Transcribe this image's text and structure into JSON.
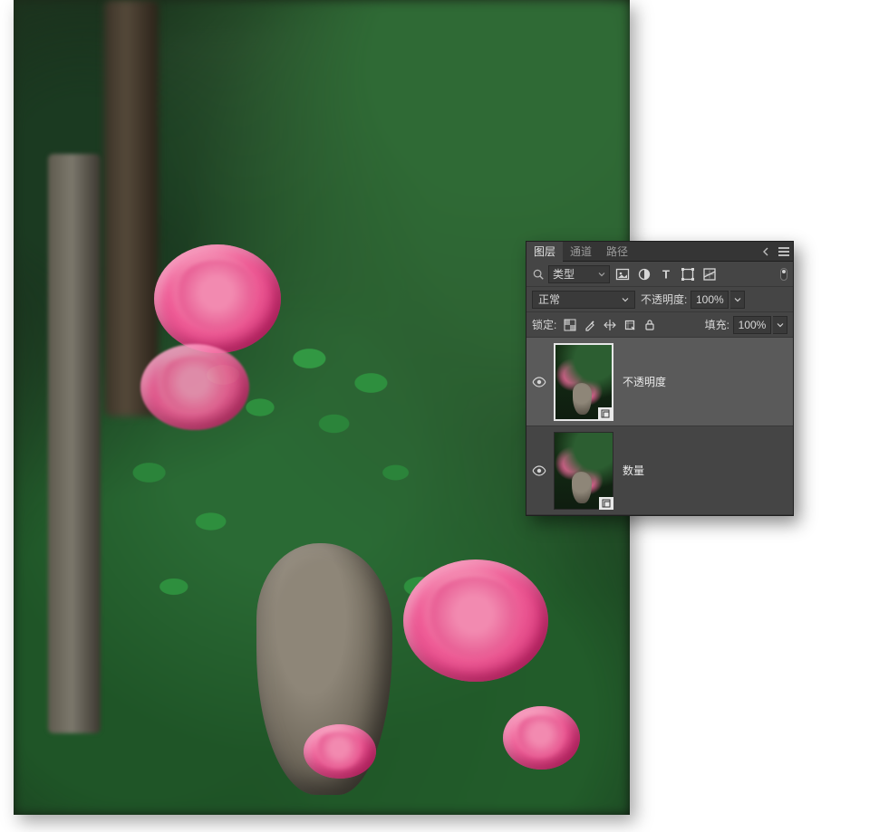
{
  "tabs": {
    "layers": "图层",
    "channels": "通道",
    "paths": "路径"
  },
  "filter": {
    "type_label": "类型",
    "filter_icons": {
      "image": "image-filter-icon",
      "adjustment": "adjustment-filter-icon",
      "text": "text-filter-icon",
      "shape": "shape-filter-icon",
      "smart": "smart-filter-icon"
    }
  },
  "blend": {
    "mode": "正常",
    "opacity_label": "不透明度:",
    "opacity_value": "100%"
  },
  "lock": {
    "label": "锁定:",
    "fill_label": "填充:",
    "fill_value": "100%"
  },
  "layers": [
    {
      "name": "不透明度",
      "visible": true,
      "selected": true,
      "smart_object": true
    },
    {
      "name": "数量",
      "visible": true,
      "selected": false,
      "smart_object": true
    }
  ]
}
